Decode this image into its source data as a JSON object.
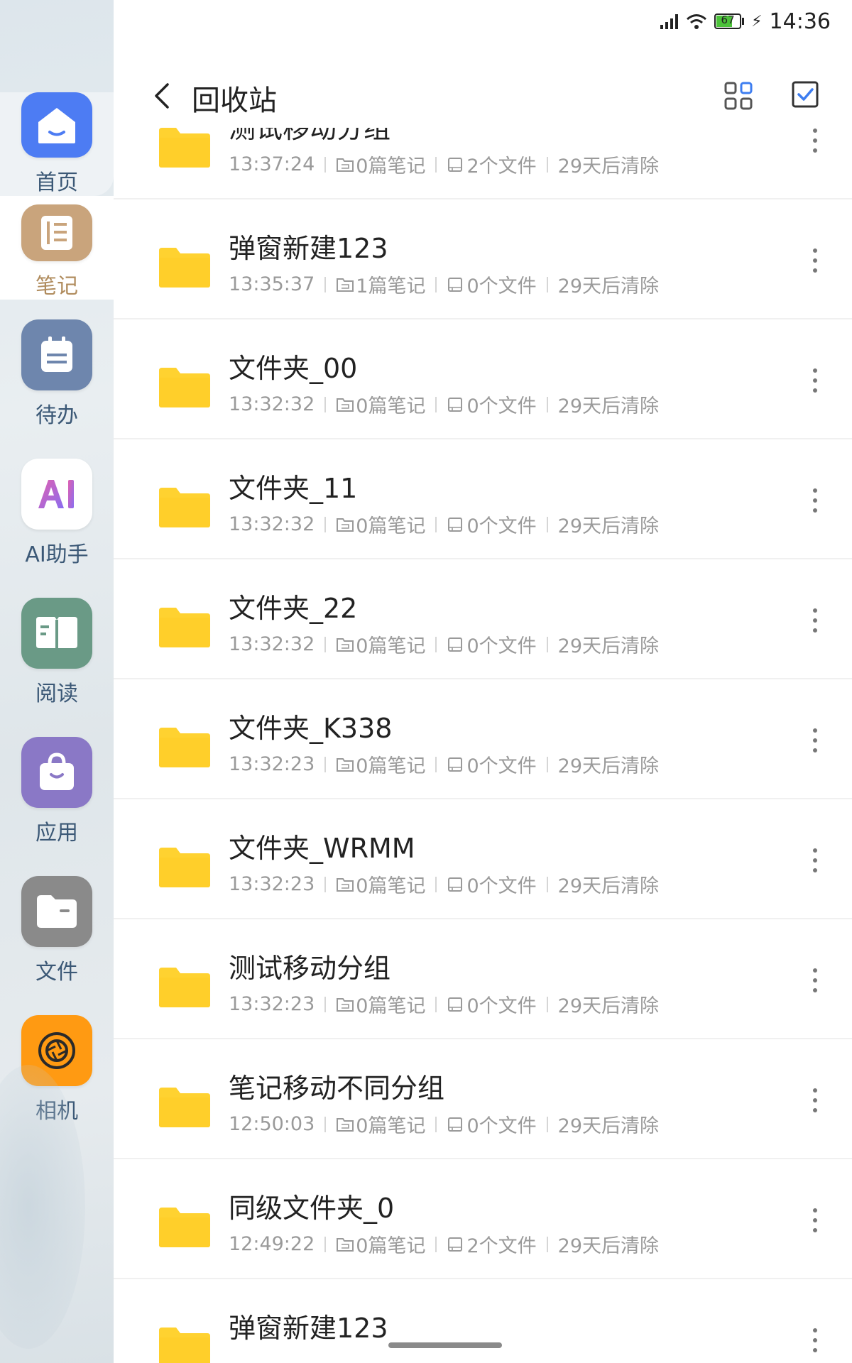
{
  "status": {
    "battery": "67",
    "time": "14:36"
  },
  "header": {
    "title": "回收站"
  },
  "sidebar": {
    "items": [
      {
        "label": "首页",
        "icon": "home-icon",
        "color": "#4d7cf3"
      },
      {
        "label": "笔记",
        "icon": "notes-icon",
        "color": "#c9a47c"
      },
      {
        "label": "待办",
        "icon": "todo-icon",
        "color": "#6e86ad"
      },
      {
        "label": "AI助手",
        "icon": "ai-assistant-icon",
        "color": "#ffffff"
      },
      {
        "label": "阅读",
        "icon": "reading-icon",
        "color": "#6a9a86"
      },
      {
        "label": "应用",
        "icon": "apps-icon",
        "color": "#8a78c6"
      },
      {
        "label": "文件",
        "icon": "files-icon",
        "color": "#8a8a8a"
      },
      {
        "label": "相机",
        "icon": "camera-icon",
        "color": "#ff9a12"
      }
    ]
  },
  "rows": [
    {
      "title": "测试移动分组",
      "time": "13:37:24",
      "notes": "0篇笔记",
      "files": "2个文件",
      "expire": "29天后清除"
    },
    {
      "title": "弹窗新建123",
      "time": "13:35:37",
      "notes": "1篇笔记",
      "files": "0个文件",
      "expire": "29天后清除"
    },
    {
      "title": "文件夹_00",
      "time": "13:32:32",
      "notes": "0篇笔记",
      "files": "0个文件",
      "expire": "29天后清除"
    },
    {
      "title": "文件夹_11",
      "time": "13:32:32",
      "notes": "0篇笔记",
      "files": "0个文件",
      "expire": "29天后清除"
    },
    {
      "title": "文件夹_22",
      "time": "13:32:32",
      "notes": "0篇笔记",
      "files": "0个文件",
      "expire": "29天后清除"
    },
    {
      "title": "文件夹_K338",
      "time": "13:32:23",
      "notes": "0篇笔记",
      "files": "0个文件",
      "expire": "29天后清除"
    },
    {
      "title": "文件夹_WRMM",
      "time": "13:32:23",
      "notes": "0篇笔记",
      "files": "0个文件",
      "expire": "29天后清除"
    },
    {
      "title": "测试移动分组",
      "time": "13:32:23",
      "notes": "0篇笔记",
      "files": "0个文件",
      "expire": "29天后清除"
    },
    {
      "title": "笔记移动不同分组",
      "time": "12:50:03",
      "notes": "0篇笔记",
      "files": "0个文件",
      "expire": "29天后清除"
    },
    {
      "title": "同级文件夹_0",
      "time": "12:49:22",
      "notes": "0篇笔记",
      "files": "2个文件",
      "expire": "29天后清除"
    },
    {
      "title": "弹窗新建123",
      "time": "",
      "notes": "",
      "files": "",
      "expire": ""
    }
  ],
  "colors": {
    "folder": "#ffd230",
    "accent": "#3d7df0",
    "meta_text": "#9a9a9a"
  }
}
